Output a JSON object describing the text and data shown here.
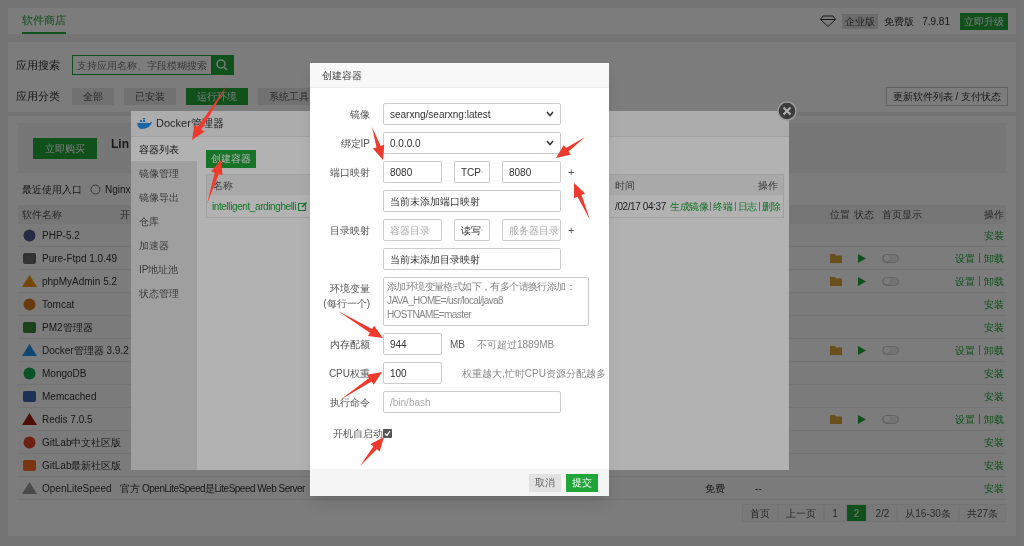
{
  "top_bar": {
    "tab": "软件商店",
    "edition_badge": "企业版",
    "plan": "免费版",
    "version": "7.9.81",
    "upgrade_button": "立即升级"
  },
  "search": {
    "label": "应用搜索",
    "placeholder": "支持应用名称、字段模糊搜索"
  },
  "categories": {
    "label": "应用分类",
    "items": [
      {
        "label": "全部",
        "selected": false
      },
      {
        "label": "已安装",
        "selected": false
      },
      {
        "label": "运行环境",
        "selected": true
      },
      {
        "label": "系统工具",
        "selected": false
      }
    ]
  },
  "refresh_button": "更新软件列表 / 支付状态",
  "promo": {
    "buy_button": "立即购买",
    "title": "Lin"
  },
  "recent": {
    "label": "最近使用入口",
    "items": [
      "Nginx"
    ]
  },
  "table": {
    "columns": [
      "软件名称",
      "开",
      "位置",
      "状态",
      "首页显示",
      "操作"
    ],
    "rows": [
      {
        "name": "PHP-5.2",
        "installed": false,
        "actions": [
          "安装"
        ]
      },
      {
        "name": "Pure-Ftpd 1.0.49",
        "installed": true,
        "homepage_shown": false,
        "actions": [
          "设置",
          "卸载"
        ]
      },
      {
        "name": "phpMyAdmin 5.2",
        "installed": true,
        "homepage_shown": false,
        "actions": [
          "设置",
          "卸载"
        ]
      },
      {
        "name": "Tomcat",
        "installed": false,
        "actions": [
          "安装"
        ]
      },
      {
        "name": "PM2管理器",
        "installed": false,
        "actions": [
          "安装"
        ]
      },
      {
        "name": "Docker管理器 3.9.2",
        "installed": true,
        "homepage_shown": false,
        "actions": [
          "设置",
          "卸载"
        ]
      },
      {
        "name": "MongoDB",
        "installed": false,
        "actions": [
          "安装"
        ]
      },
      {
        "name": "Memcached",
        "installed": false,
        "actions": [
          "安装"
        ]
      },
      {
        "name": "Redis 7.0.5",
        "installed": true,
        "homepage_shown": false,
        "actions": [
          "设置",
          "卸载"
        ]
      },
      {
        "name": "GitLab中文社区版",
        "installed": false,
        "actions": [
          "安装"
        ]
      },
      {
        "name": "GitLab最新社区版",
        "installed": false,
        "actions": [
          "安装"
        ]
      },
      {
        "name": "OpenLiteSpeed",
        "installed": false,
        "developer": "官方",
        "description": "OpenLiteSpeed是LiteSpeed Web Server",
        "price": "免费",
        "expiry": "--",
        "actions": [
          "安装"
        ]
      }
    ]
  },
  "pagination": [
    {
      "label": "首页",
      "selected": false
    },
    {
      "label": "上一页",
      "selected": false
    },
    {
      "label": "1",
      "selected": false
    },
    {
      "label": "2",
      "selected": true
    },
    {
      "label": "2/2",
      "selected": false
    },
    {
      "label": "从16-30条",
      "selected": false
    },
    {
      "label": "共27条",
      "selected": false
    }
  ],
  "docker_manager": {
    "title": "Docker管理器",
    "menu": [
      {
        "label": "容器列表",
        "selected": true
      },
      {
        "label": "镜像管理",
        "selected": false
      },
      {
        "label": "镜像导出",
        "selected": false
      },
      {
        "label": "仓库",
        "selected": false
      },
      {
        "label": "加速器",
        "selected": false
      },
      {
        "label": "IP地址池",
        "selected": false
      },
      {
        "label": "状态管理",
        "selected": false
      }
    ],
    "create_button": "创建容器",
    "table": {
      "columns": [
        "名称",
        "时间",
        "操作"
      ],
      "rows": [
        {
          "name": "intelligent_ardinghelli",
          "time": "/02/17 04:37",
          "actions": [
            "生成镜像",
            "终端",
            "日志",
            "删除"
          ]
        }
      ]
    }
  },
  "create_dialog": {
    "title": "创建容器",
    "image": {
      "label": "镜像",
      "value": "searxng/searxng:latest"
    },
    "bind_ip": {
      "label": "绑定IP",
      "value": "0.0.0.0"
    },
    "port": {
      "label": "端口映射",
      "container_port": "8080",
      "protocol": "TCP",
      "host_port": "8080",
      "add": "+",
      "list_hint": "当前未添加端口映射"
    },
    "volume": {
      "label": "目录映射",
      "container_placeholder": "容器目录",
      "mode": "读写",
      "host_placeholder": "服务器目录",
      "add": "+",
      "list_hint": "当前未添加目录映射"
    },
    "env": {
      "label": "环境变量",
      "sublabel": "(每行一个)",
      "placeholder": "添加环境变量格式如下，有多个请换行添加：\nJAVA_HOME=/usr/local/java8\nHOSTNAME=master"
    },
    "memory": {
      "label": "内存配额",
      "value": "944",
      "unit": "MB",
      "hint": "不可超过1889MB"
    },
    "cpu": {
      "label": "CPU权重",
      "value": "100",
      "hint": "权重越大,忙时CPU资源分配越多"
    },
    "command": {
      "label": "执行命令",
      "placeholder": "/bin/bash"
    },
    "autostart": {
      "label": "开机自启动",
      "checked": true
    },
    "cancel_button": "取消",
    "submit_button": "提交"
  }
}
